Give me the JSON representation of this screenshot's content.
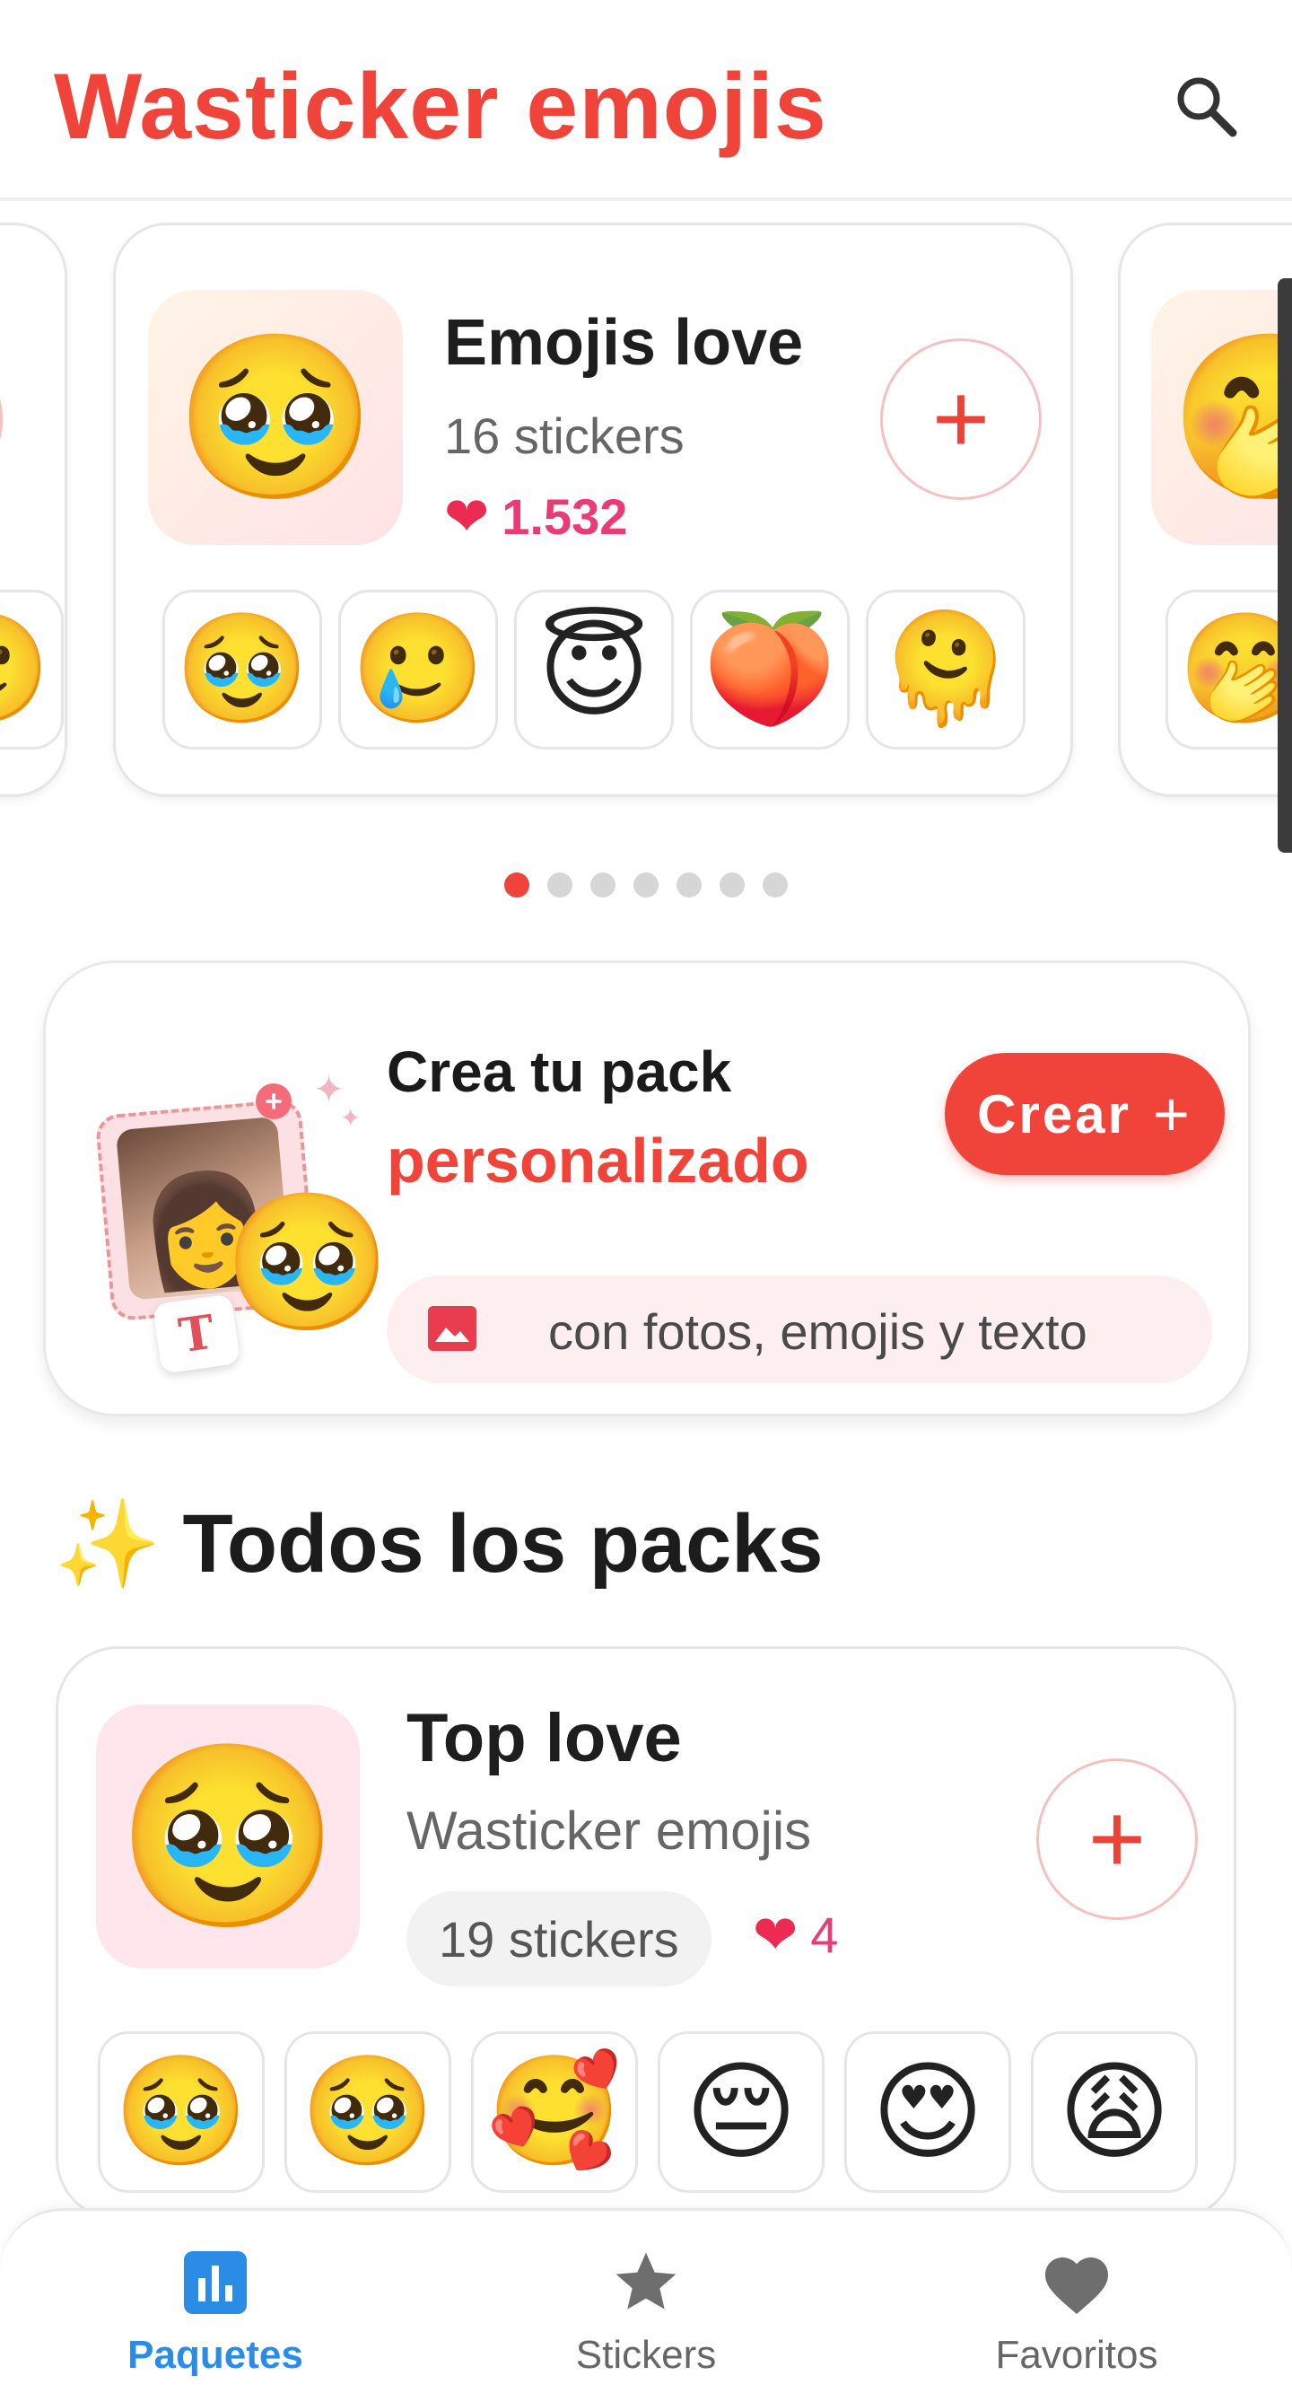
{
  "header": {
    "title": "Wasticker emojis",
    "search_icon": "search-icon"
  },
  "featured": {
    "pack_title": "Emojis love",
    "pack_count": "16 stickers",
    "pack_likes": "1.532",
    "thumb_emoji": "🥹",
    "previews": [
      "🥹",
      "🥲",
      "😇",
      "🍑",
      "🫠"
    ],
    "right_thumb_emoji": "🤭",
    "right_previews": [
      "🤭"
    ],
    "left_previews": [
      "🙂"
    ]
  },
  "carousel": {
    "dot_count": 7,
    "active_index": 0
  },
  "create": {
    "title": "Crea tu pack",
    "subtitle": "personalizado",
    "button_label": "Crear",
    "pill_text": "con fotos, emojis y texto",
    "tile_letter": "T"
  },
  "section": {
    "title": "Todos los packs"
  },
  "packs": [
    {
      "title": "Top love",
      "author": "Wasticker emojis",
      "count": "19 stickers",
      "likes": "4",
      "thumb_emoji": "🥹",
      "previews": [
        "🥹",
        "🥹",
        "🥰",
        "😔",
        "😍",
        "😩"
      ]
    }
  ],
  "nav": {
    "items": [
      {
        "label": "Paquetes",
        "icon": "chart-icon",
        "active": true
      },
      {
        "label": "Stickers",
        "icon": "star-icon",
        "active": false
      },
      {
        "label": "Favoritos",
        "icon": "heart-icon",
        "active": false
      }
    ]
  },
  "colors": {
    "brand_red": "#f0443a",
    "like_pink": "#ea3b75",
    "nav_active": "#2b8ce6",
    "nav_inactive": "#6e6e6e"
  }
}
